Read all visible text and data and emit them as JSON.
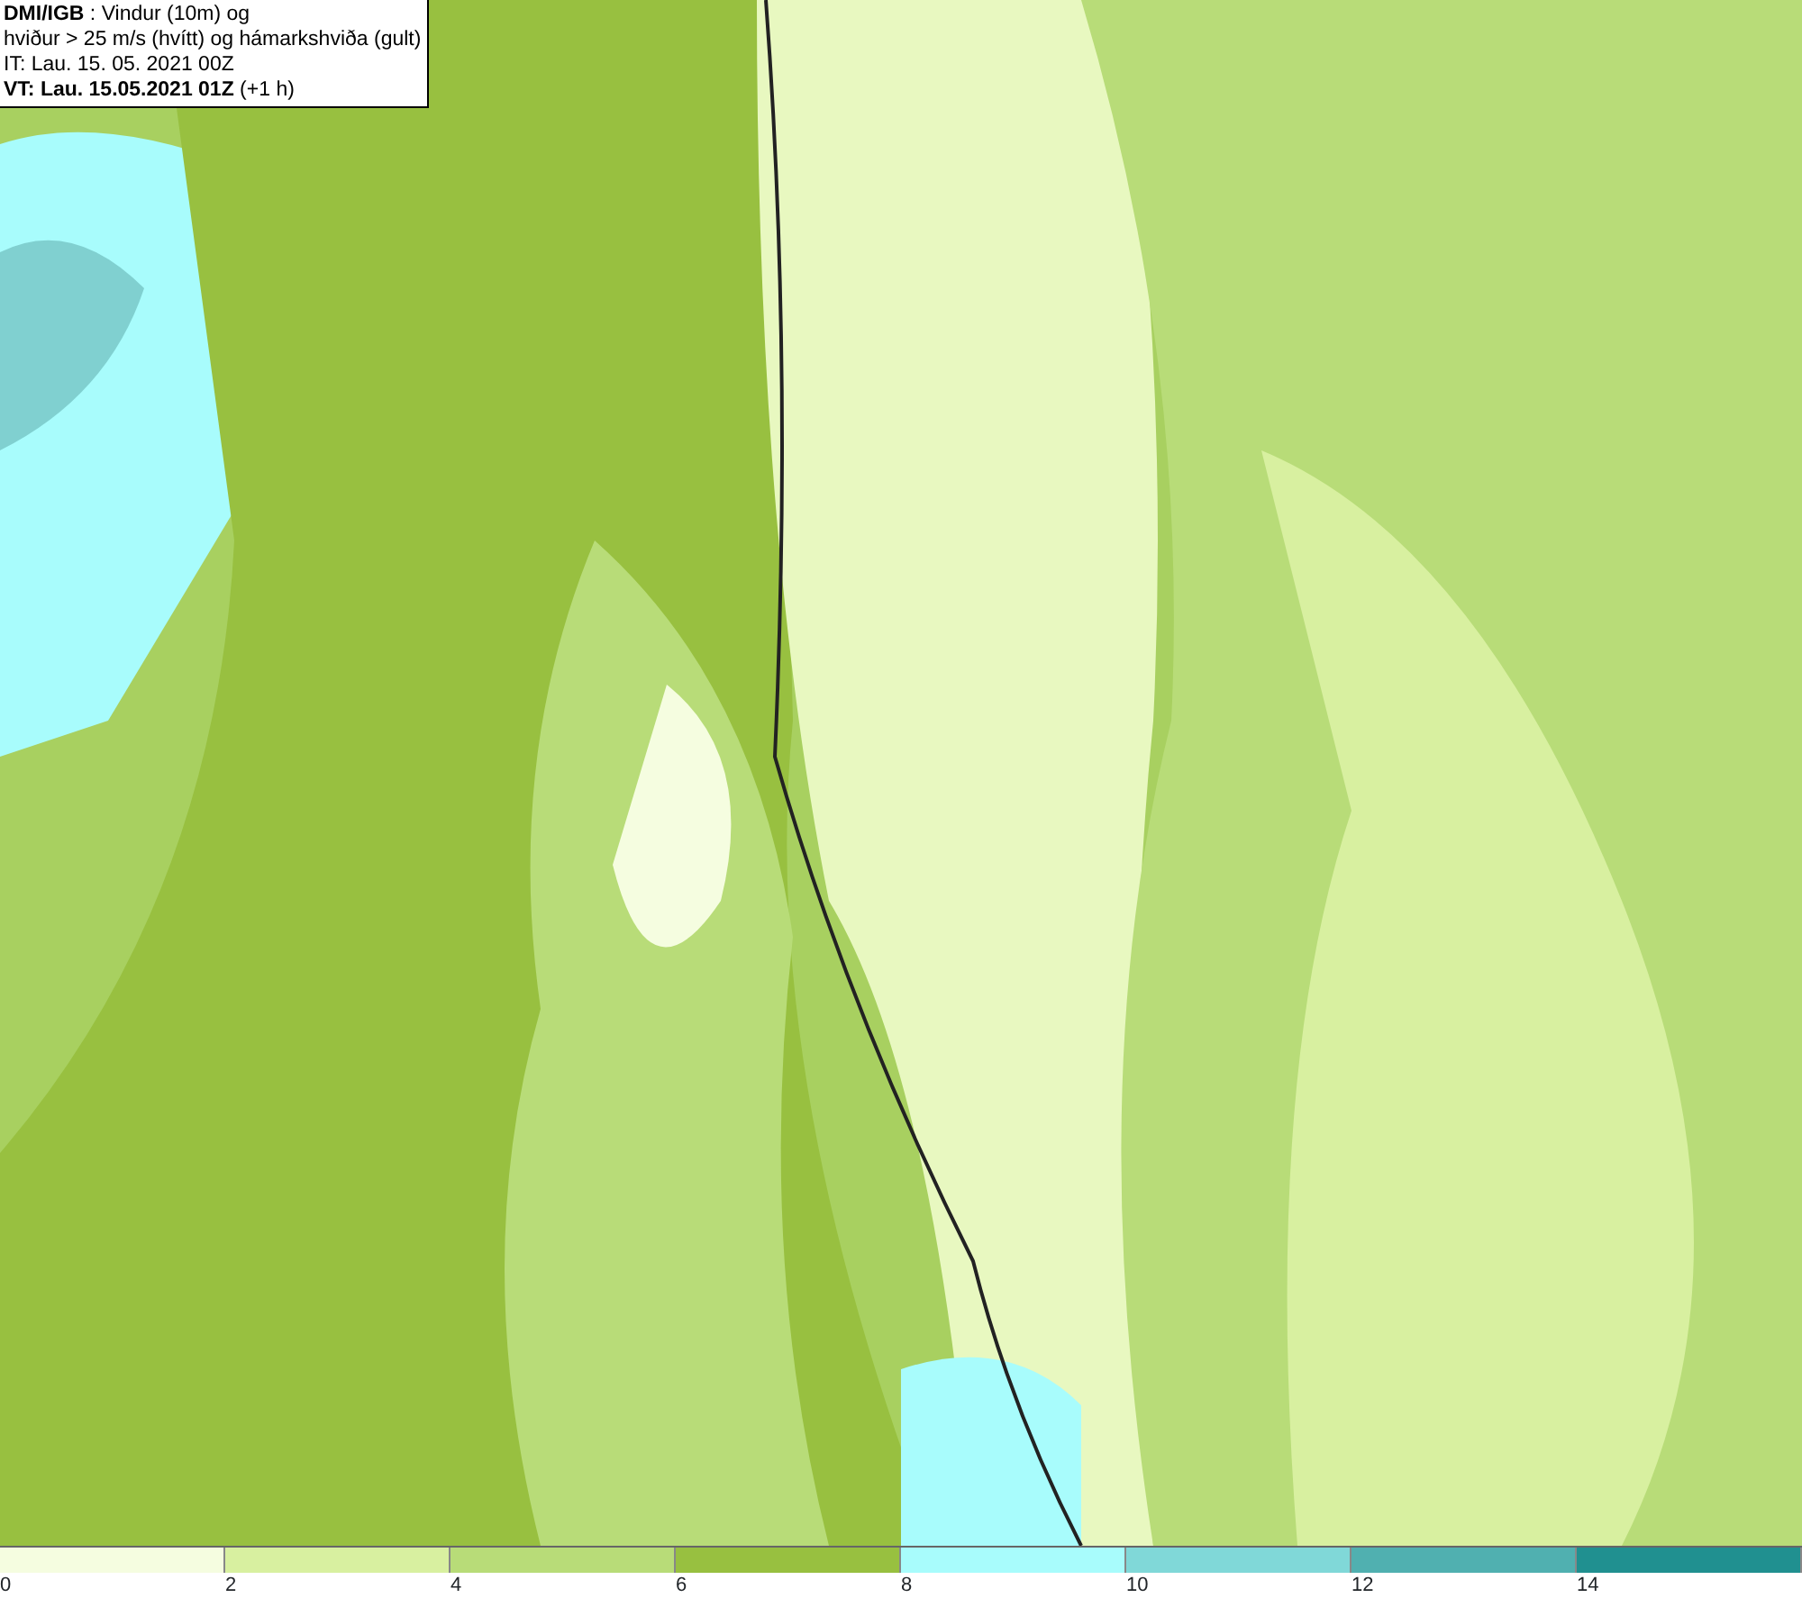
{
  "title_box": {
    "lines": [
      "**DMI/IGB** : Vindur (10m) og",
      "hviður > 25 m/s (hvítt) og hámarkshviða (gult)",
      "IT: Lau. 15. 05. 2021 00Z",
      "**VT: Lau. 15.05.2021 01Z** (+1 h)"
    ]
  },
  "legend": {
    "bins": [
      {
        "color": "#f5fde0"
      },
      {
        "color": "#d8f0a0"
      },
      {
        "color": "#b8dc78"
      },
      {
        "color": "#98c040"
      },
      {
        "color": "#a8fcfc"
      },
      {
        "color": "#80d8d8"
      },
      {
        "color": "#50b0b0"
      },
      {
        "color": "#209090"
      }
    ],
    "ticks": [
      "0",
      "2",
      "4",
      "6",
      "8",
      "10",
      "12",
      "14"
    ]
  }
}
